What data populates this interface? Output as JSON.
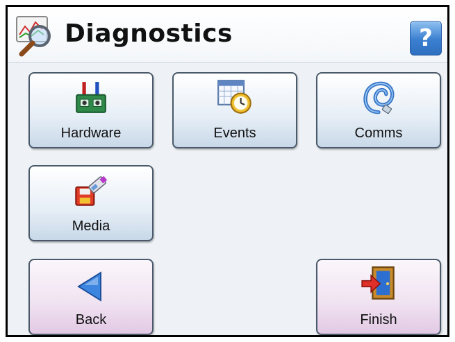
{
  "header": {
    "title": "Diagnostics",
    "help_label": "?",
    "icon": "diagnostics-magnifier-icon"
  },
  "menu": {
    "hardware": {
      "label": "Hardware",
      "icon": "hardware-icon"
    },
    "events": {
      "label": "Events",
      "icon": "calendar-clock-icon"
    },
    "comms": {
      "label": "Comms",
      "icon": "network-cable-icon"
    },
    "media": {
      "label": "Media",
      "icon": "usb-floppy-icon"
    }
  },
  "nav": {
    "back": {
      "label": "Back",
      "icon": "back-arrow-icon"
    },
    "finish": {
      "label": "Finish",
      "icon": "exit-door-icon"
    }
  },
  "colors": {
    "background": "#eef2f6",
    "button_blue": "#c8d8e8",
    "button_pink": "#e2c9e4",
    "help_blue": "#3a7fd0"
  }
}
